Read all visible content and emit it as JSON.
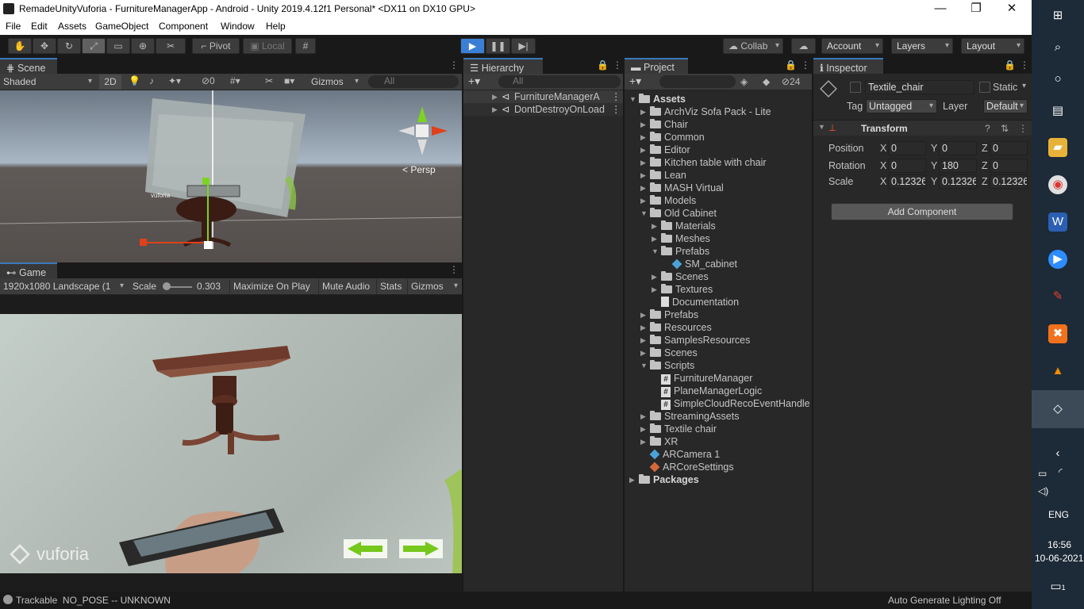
{
  "window": {
    "title": "RemadeUnityVuforia - FurnitureManagerApp - Android - Unity 2019.4.12f1 Personal* <DX11 on DX10 GPU>"
  },
  "menu": [
    "File",
    "Edit",
    "Assets",
    "GameObject",
    "Component",
    "Window",
    "Help"
  ],
  "toolbar": {
    "pivot": "Pivot",
    "local": "Local",
    "collab": "Collab",
    "account": "Account",
    "layers": "Layers",
    "layout": "Layout"
  },
  "scene": {
    "tab": "Scene",
    "shading": "Shaded",
    "mode2d": "2D",
    "gizmos": "Gizmos",
    "search_placeholder": "All",
    "persp": "Persp",
    "vuforia_mark": "vuforia"
  },
  "game": {
    "tab": "Game",
    "resolution": "1920x1080 Landscape (1",
    "scale_label": "Scale",
    "scale_value": "0.303",
    "maximize": "Maximize On Play",
    "mute": "Mute Audio",
    "stats": "Stats",
    "gizmos": "Gizmos",
    "vuforia_logo": "vuforia"
  },
  "hierarchy": {
    "tab": "Hierarchy",
    "search_placeholder": "All",
    "items": [
      "FurnitureManagerA",
      "DontDestroyOnLoad"
    ]
  },
  "project": {
    "tab": "Project",
    "hidden_count": "24",
    "tree": [
      {
        "label": "Assets",
        "depth": 0,
        "type": "folder",
        "state": "open",
        "bold": true
      },
      {
        "label": "ArchViz Sofa Pack - Lite",
        "depth": 1,
        "type": "folder",
        "state": "closed"
      },
      {
        "label": "Chair",
        "depth": 1,
        "type": "folder",
        "state": "closed"
      },
      {
        "label": "Common",
        "depth": 1,
        "type": "folder",
        "state": "closed"
      },
      {
        "label": "Editor",
        "depth": 1,
        "type": "folder",
        "state": "closed"
      },
      {
        "label": "Kitchen table with chair",
        "depth": 1,
        "type": "folder",
        "state": "closed"
      },
      {
        "label": "Lean",
        "depth": 1,
        "type": "folder",
        "state": "closed"
      },
      {
        "label": "MASH Virtual",
        "depth": 1,
        "type": "folder",
        "state": "closed"
      },
      {
        "label": "Models",
        "depth": 1,
        "type": "folder",
        "state": "closed"
      },
      {
        "label": "Old Cabinet",
        "depth": 1,
        "type": "folder",
        "state": "open"
      },
      {
        "label": "Materials",
        "depth": 2,
        "type": "folder",
        "state": "closed"
      },
      {
        "label": "Meshes",
        "depth": 2,
        "type": "folder",
        "state": "closed"
      },
      {
        "label": "Prefabs",
        "depth": 2,
        "type": "folder",
        "state": "open"
      },
      {
        "label": "SM_cabinet",
        "depth": 3,
        "type": "prefab",
        "state": "none"
      },
      {
        "label": "Scenes",
        "depth": 2,
        "type": "folder",
        "state": "closed"
      },
      {
        "label": "Textures",
        "depth": 2,
        "type": "folder",
        "state": "closed"
      },
      {
        "label": "Documentation",
        "depth": 2,
        "type": "doc",
        "state": "none"
      },
      {
        "label": "Prefabs",
        "depth": 1,
        "type": "folder",
        "state": "closed"
      },
      {
        "label": "Resources",
        "depth": 1,
        "type": "folder",
        "state": "closed"
      },
      {
        "label": "SamplesResources",
        "depth": 1,
        "type": "folder",
        "state": "closed"
      },
      {
        "label": "Scenes",
        "depth": 1,
        "type": "folder",
        "state": "closed"
      },
      {
        "label": "Scripts",
        "depth": 1,
        "type": "folder",
        "state": "open"
      },
      {
        "label": "FurnitureManager",
        "depth": 2,
        "type": "script",
        "state": "none"
      },
      {
        "label": "PlaneManagerLogic",
        "depth": 2,
        "type": "script",
        "state": "none"
      },
      {
        "label": "SimpleCloudRecoEventHandle",
        "depth": 2,
        "type": "script",
        "state": "none"
      },
      {
        "label": "StreamingAssets",
        "depth": 1,
        "type": "folder",
        "state": "closed"
      },
      {
        "label": "Textile chair",
        "depth": 1,
        "type": "folder",
        "state": "closed"
      },
      {
        "label": "XR",
        "depth": 1,
        "type": "folder",
        "state": "closed"
      },
      {
        "label": "ARCamera 1",
        "depth": 1,
        "type": "prefab",
        "state": "none"
      },
      {
        "label": "ARCoreSettings",
        "depth": 1,
        "type": "settings",
        "state": "none"
      },
      {
        "label": "Packages",
        "depth": 0,
        "type": "folder",
        "state": "closed",
        "bold": true
      }
    ]
  },
  "inspector": {
    "tab": "Inspector",
    "object_name": "Textile_chair",
    "static": "Static",
    "tag_label": "Tag",
    "tag_value": "Untagged",
    "layer_label": "Layer",
    "layer_value": "Default",
    "transform": "Transform",
    "position_label": "Position",
    "rotation_label": "Rotation",
    "scale_label": "Scale",
    "axes": [
      "X",
      "Y",
      "Z"
    ],
    "position": [
      "0",
      "0",
      "0"
    ],
    "rotation": [
      "0",
      "180",
      "0"
    ],
    "scale": [
      "0.12326",
      "0.12326",
      "0.12326"
    ],
    "add_component": "Add Component"
  },
  "status": {
    "left": "Trackable  NO_POSE -- UNKNOWN",
    "right": "Auto Generate Lighting Off"
  },
  "taskbar": {
    "language": "ENG",
    "time": "16:56",
    "date": "10-06-2021",
    "notif": "1"
  }
}
